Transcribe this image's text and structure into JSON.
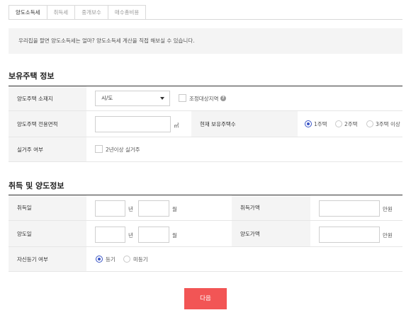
{
  "tabs": [
    {
      "label": "양도소득세",
      "active": true
    },
    {
      "label": "취득세",
      "active": false
    },
    {
      "label": "중개보수",
      "active": false
    },
    {
      "label": "매수총비용",
      "active": false
    }
  ],
  "notice": "우리집을 팔면 양도소득세는 얼마? 양도소득세 계산을 직접 해보실 수 있습니다.",
  "section1": {
    "title": "보유주택 정보",
    "location_label": "양도주택 소재지",
    "location_select": "시/도",
    "regulated_label": "조정대상지역",
    "help_icon": "?",
    "area_label": "양도주택 전용면적",
    "area_unit": "㎡",
    "count_label": "현재 보유주택수",
    "count_options": [
      "1주택",
      "2주택",
      "3주택 이상"
    ],
    "count_selected": 0,
    "residence_label": "실거주 여부",
    "residence_check_label": "2년이상 실거주"
  },
  "section2": {
    "title": "취득 및 양도정보",
    "acquire_date_label": "취득일",
    "transfer_date_label": "양도일",
    "year_unit": "년",
    "month_unit": "월",
    "acquire_price_label": "취득가액",
    "transfer_price_label": "양도가액",
    "price_unit": "만원",
    "registry_label": "자신등기 여부",
    "registry_options": [
      "등기",
      "미등기"
    ],
    "registry_selected": 0
  },
  "next_button": "다음",
  "colors": {
    "accent_blue": "#3a55c6",
    "button_red": "#f25555",
    "label_bg": "#f4f4f4"
  }
}
